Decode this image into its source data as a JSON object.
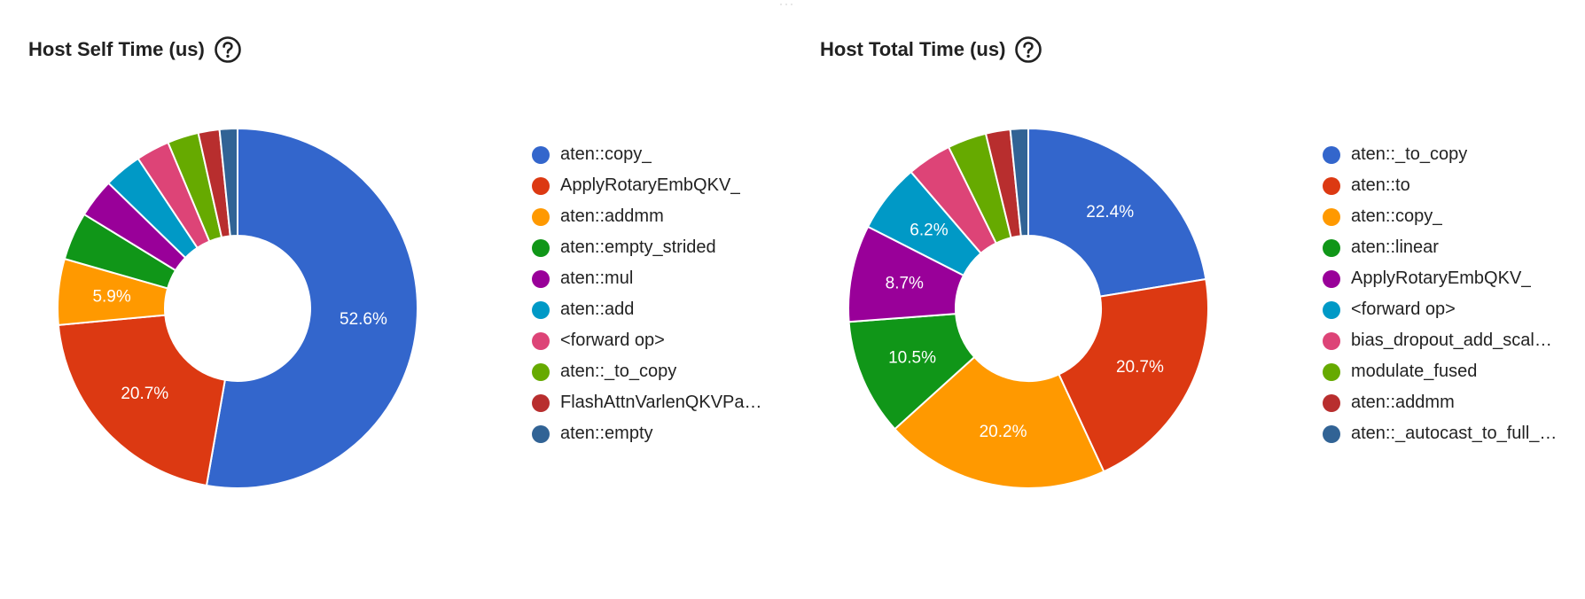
{
  "charts": [
    {
      "title": "Host Self Time (us)",
      "help_icon": "question-circle-icon",
      "legend": [
        "aten::copy_",
        "ApplyRotaryEmbQKV_",
        "aten::addmm",
        "aten::empty_strided",
        "aten::mul",
        "aten::add",
        "<forward op>",
        "aten::_to_copy",
        "FlashAttnVarlenQKVPa…",
        "aten::empty"
      ]
    },
    {
      "title": "Host Total Time (us)",
      "help_icon": "question-circle-icon",
      "legend": [
        "aten::_to_copy",
        "aten::to",
        "aten::copy_",
        "aten::linear",
        "ApplyRotaryEmbQKV_",
        "<forward op>",
        "bias_dropout_add_scal…",
        "modulate_fused",
        "aten::addmm",
        "aten::_autocast_to_full_…"
      ]
    }
  ],
  "chart_data": [
    {
      "type": "pie",
      "title": "Host Self Time (us)",
      "donut": true,
      "legend_position": "right",
      "categories": [
        "aten::copy_",
        "ApplyRotaryEmbQKV_",
        "aten::addmm",
        "aten::empty_strided",
        "aten::mul",
        "aten::add",
        "<forward op>",
        "aten::_to_copy",
        "FlashAttnVarlenQKVPa…",
        "aten::empty"
      ],
      "values": [
        52.6,
        20.7,
        5.9,
        4.3,
        3.5,
        3.4,
        3.0,
        2.8,
        1.9,
        1.6
      ],
      "data_labels": [
        "52.6%",
        "20.7%",
        "5.9%",
        "",
        "",
        "",
        "",
        "",
        "",
        ""
      ],
      "colors": [
        "#3366cc",
        "#dc3912",
        "#ff9900",
        "#109618",
        "#990099",
        "#0099c6",
        "#dd4477",
        "#66aa00",
        "#b82e2e",
        "#316395"
      ]
    },
    {
      "type": "pie",
      "title": "Host Total Time (us)",
      "donut": true,
      "legend_position": "right",
      "categories": [
        "aten::_to_copy",
        "aten::to",
        "aten::copy_",
        "aten::linear",
        "ApplyRotaryEmbQKV_",
        "<forward op>",
        "bias_dropout_add_scal…",
        "modulate_fused",
        "aten::addmm",
        "aten::_autocast_to_full_…"
      ],
      "values": [
        22.4,
        20.7,
        20.2,
        10.5,
        8.7,
        6.2,
        4.0,
        3.5,
        2.2,
        1.6
      ],
      "data_labels": [
        "22.4%",
        "20.7%",
        "20.2%",
        "10.5%",
        "8.7%",
        "6.2%",
        "",
        "",
        "",
        ""
      ],
      "colors": [
        "#3366cc",
        "#dc3912",
        "#ff9900",
        "#109618",
        "#990099",
        "#0099c6",
        "#dd4477",
        "#66aa00",
        "#b82e2e",
        "#316395"
      ]
    }
  ]
}
